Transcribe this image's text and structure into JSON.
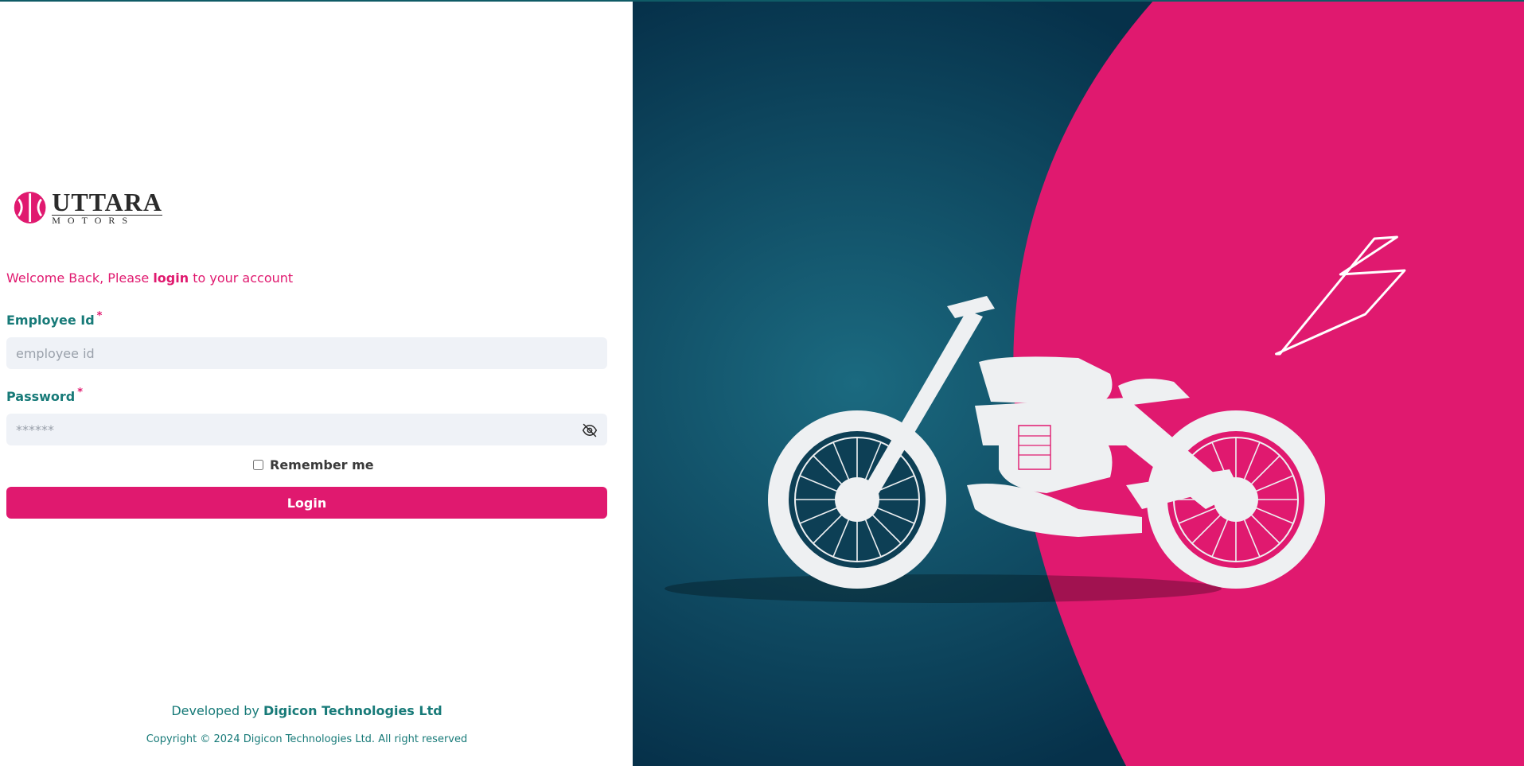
{
  "brand": {
    "name": "UTTARA",
    "tagline": "MOTORS",
    "accent_color": "#e0196f",
    "teal_color": "#177a78",
    "navy_color": "#06314a"
  },
  "login": {
    "welcome_prefix": "Welcome Back, Please",
    "welcome_link": "login",
    "welcome_suffix": "to your account",
    "employee_label": "Employee Id",
    "employee_placeholder": "employee id",
    "password_label": "Password",
    "password_placeholder": "******",
    "required_mark": "*",
    "remember_label": "Remember me",
    "remember_checked": false,
    "submit_label": "Login",
    "password_toggle_icon": "eye-off-icon"
  },
  "footer": {
    "developed_by": "Developed by",
    "developer_name": "Digicon Technologies Ltd",
    "copyright": "Copyright © 2024 Digicon Technologies Ltd. All right reserved"
  },
  "illustration": {
    "subject": "motorcycle",
    "icons": [
      "motorcycle-icon",
      "lightning-icon"
    ]
  }
}
